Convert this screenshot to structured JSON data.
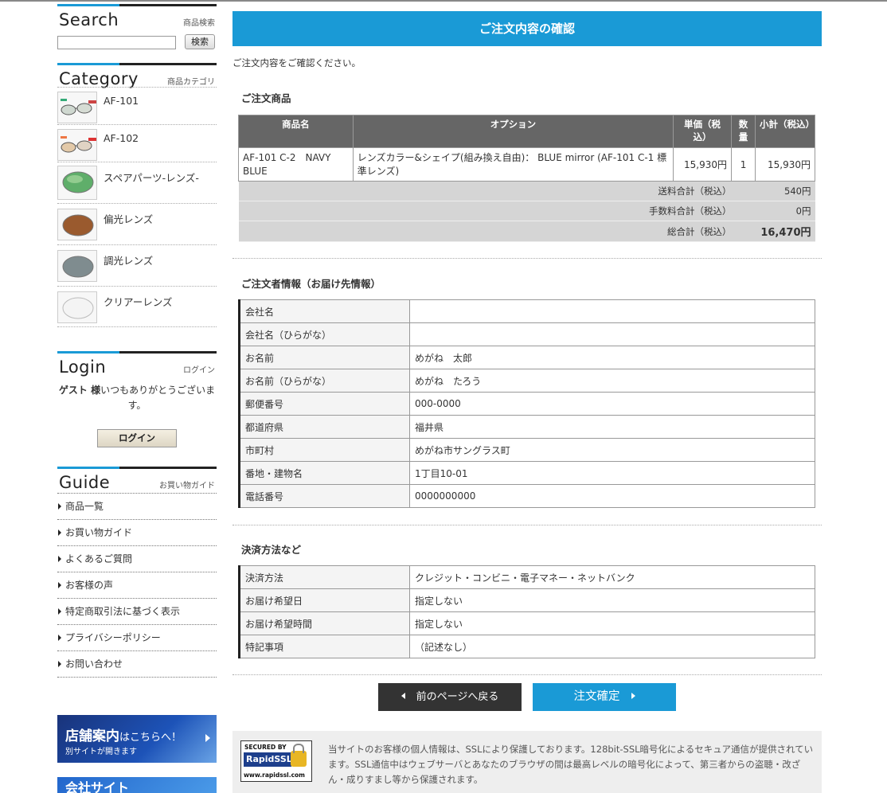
{
  "sidebar": {
    "search": {
      "title": "Search",
      "subtitle": "商品検索",
      "input_value": "",
      "button_label": "検索"
    },
    "category": {
      "title": "Category",
      "subtitle": "商品カテゴリ",
      "items": [
        {
          "label": "AF-101"
        },
        {
          "label": "AF-102"
        },
        {
          "label": "スペアパーツ-レンズ-"
        },
        {
          "label": "偏光レンズ"
        },
        {
          "label": "調光レンズ"
        },
        {
          "label": "クリアーレンズ"
        }
      ]
    },
    "login": {
      "title": "Login",
      "subtitle": "ログイン",
      "guest_name": "ゲスト 様",
      "greeting": "いつもありがとうございます。",
      "button_label": "ログイン"
    },
    "guide": {
      "title": "Guide",
      "subtitle": "お買い物ガイド",
      "items": [
        "商品一覧",
        "お買い物ガイド",
        "よくあるご質問",
        "お客様の声",
        "特定商取引法に基づく表示",
        "プライバシーポリシー",
        "お問い合わせ"
      ]
    },
    "banner": {
      "title": "店舗案内",
      "title_suffix": "はこちらへ！",
      "subtitle": "別サイトが開きます"
    },
    "banner2": {
      "text": "会社サイト"
    }
  },
  "main": {
    "title": "ご注文内容の確認",
    "intro": "ご注文内容をご確認ください。",
    "products": {
      "section_title": "ご注文商品",
      "headers": {
        "name": "商品名",
        "option": "オプション",
        "unit_price": "単価（税込）",
        "qty": "数量",
        "subtotal": "小計（税込）"
      },
      "rows": [
        {
          "name": "AF-101 C-2　NAVY BLUE",
          "option": "レンズカラー&シェイプ(組み換え自由)： BLUE mirror (AF-101 C-1 標準レンズ)",
          "unit_price": "15,930円",
          "qty": "1",
          "subtotal": "15,930円"
        }
      ],
      "shipping_label": "送料合計（税込）",
      "shipping_value": "540円",
      "fee_label": "手数料合計（税込）",
      "fee_value": "0円",
      "total_label": "総合計（税込）",
      "total_value": "16,470円"
    },
    "orderer": {
      "section_title": "ご注文者情報（お届け先情報）",
      "rows": [
        {
          "key": "会社名",
          "value": ""
        },
        {
          "key": "会社名（ひらがな）",
          "value": ""
        },
        {
          "key": "お名前",
          "value": "めがね　太郎"
        },
        {
          "key": "お名前（ひらがな）",
          "value": "めがね　たろう"
        },
        {
          "key": "郵便番号",
          "value": "000-0000"
        },
        {
          "key": "都道府県",
          "value": "福井県"
        },
        {
          "key": "市町村",
          "value": "めがね市サングラス町"
        },
        {
          "key": "番地・建物名",
          "value": "1丁目10-01"
        },
        {
          "key": "電話番号",
          "value": "0000000000"
        }
      ]
    },
    "payment": {
      "section_title": "決済方法など",
      "rows": [
        {
          "key": "決済方法",
          "value": "クレジット・コンビニ・電子マネー・ネットバンク"
        },
        {
          "key": "お届け希望日",
          "value": "指定しない"
        },
        {
          "key": "お届け希望時間",
          "value": "指定しない"
        },
        {
          "key": "特記事項",
          "value": "（記述なし）"
        }
      ]
    },
    "buttons": {
      "back": "前のページへ戻る",
      "confirm": "注文確定"
    },
    "ssl": {
      "logo_top": "SECURED BY",
      "logo_brand": "RapidSSL",
      "logo_url": "www.rapidssl.com",
      "text": "当サイトのお客様の個人情報は、SSLにより保護しております。128bit-SSL暗号化によるセキュア通信が提供されています。SSL通信中はウェブサーバとあなたのブラウザの間は最高レベルの暗号化によって、第三者からの盗聴・改ざん・成りすまし等から保護されます。"
    }
  }
}
